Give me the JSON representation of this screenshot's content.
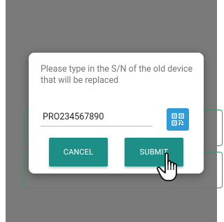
{
  "background": {
    "back_arrow": "←"
  },
  "dialog": {
    "message": "Please type in the S/N of the old device that will be replaced",
    "sn_value": "PRO234567890",
    "qr_icon": "qr-code-icon",
    "cancel_label": "CANCEL",
    "submit_label": "SUBMIT"
  },
  "colors": {
    "overlay": "#7a7a7a",
    "button": "#1e8f86",
    "qr_button": "#2f9bd7",
    "outline": "#4a8c6c"
  }
}
